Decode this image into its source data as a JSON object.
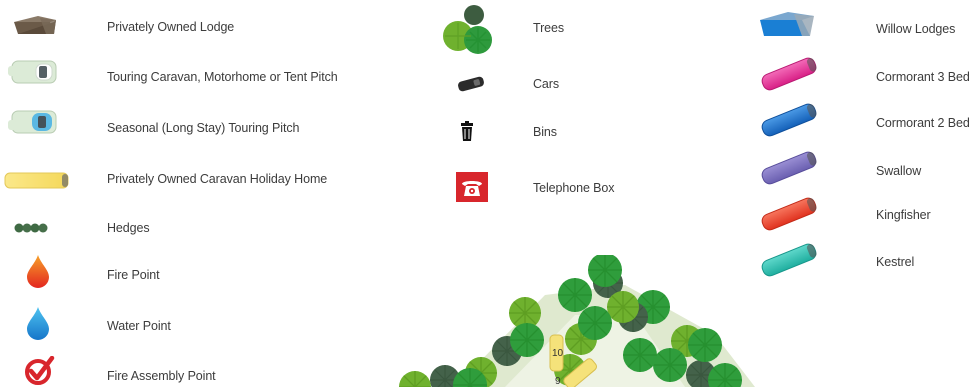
{
  "legend": {
    "col1": [
      {
        "icon": "lodge-icon",
        "label": "Privately Owned Lodge"
      },
      {
        "icon": "touring-pitch-icon",
        "label": "Touring Caravan, Motorhome or Tent Pitch"
      },
      {
        "icon": "seasonal-pitch-icon",
        "label": "Seasonal (Long Stay) Touring Pitch"
      },
      {
        "icon": "caravan-holiday-home-icon",
        "label": "Privately Owned Caravan Holiday Home"
      },
      {
        "icon": "hedges-icon",
        "label": "Hedges"
      },
      {
        "icon": "fire-point-icon",
        "label": "Fire Point"
      },
      {
        "icon": "water-point-icon",
        "label": "Water Point"
      },
      {
        "icon": "fire-assembly-point-icon",
        "label": "Fire Assembly Point"
      }
    ],
    "col2": [
      {
        "icon": "trees-icon",
        "label": "Trees"
      },
      {
        "icon": "cars-icon",
        "label": "Cars"
      },
      {
        "icon": "bin-icon",
        "label": "Bins"
      },
      {
        "icon": "telephone-box-icon",
        "label": "Telephone Box"
      }
    ],
    "col3": [
      {
        "icon": "willow-lodge-icon",
        "label": "Willow Lodges",
        "color": "#1a7fd4"
      },
      {
        "icon": "cormorant-3-bed-icon",
        "label": "Cormorant 3 Bed",
        "color": "#e8369a"
      },
      {
        "icon": "cormorant-2-bed-icon",
        "label": "Cormorant 2 Bed",
        "color": "#1f78d0"
      },
      {
        "icon": "swallow-icon",
        "label": "Swallow",
        "color": "#7d6fbf"
      },
      {
        "icon": "kingfisher-icon",
        "label": "Kingfisher",
        "color": "#ee4b3a"
      },
      {
        "icon": "kestrel-icon",
        "label": "Kestrel",
        "color": "#2bbfb0"
      }
    ]
  },
  "map": {
    "plots": [
      {
        "number": "10"
      },
      {
        "number": "9"
      }
    ]
  },
  "colors": {
    "text": "#3c3c3c",
    "tree_dark_green": "#2e8f3a",
    "tree_light_green": "#6fb12e",
    "tree_grey_green": "#4a6a4c",
    "grass": "#dfe9cf",
    "caravan_yellow": "#f5e27a",
    "telephone_red": "#d8262c"
  }
}
